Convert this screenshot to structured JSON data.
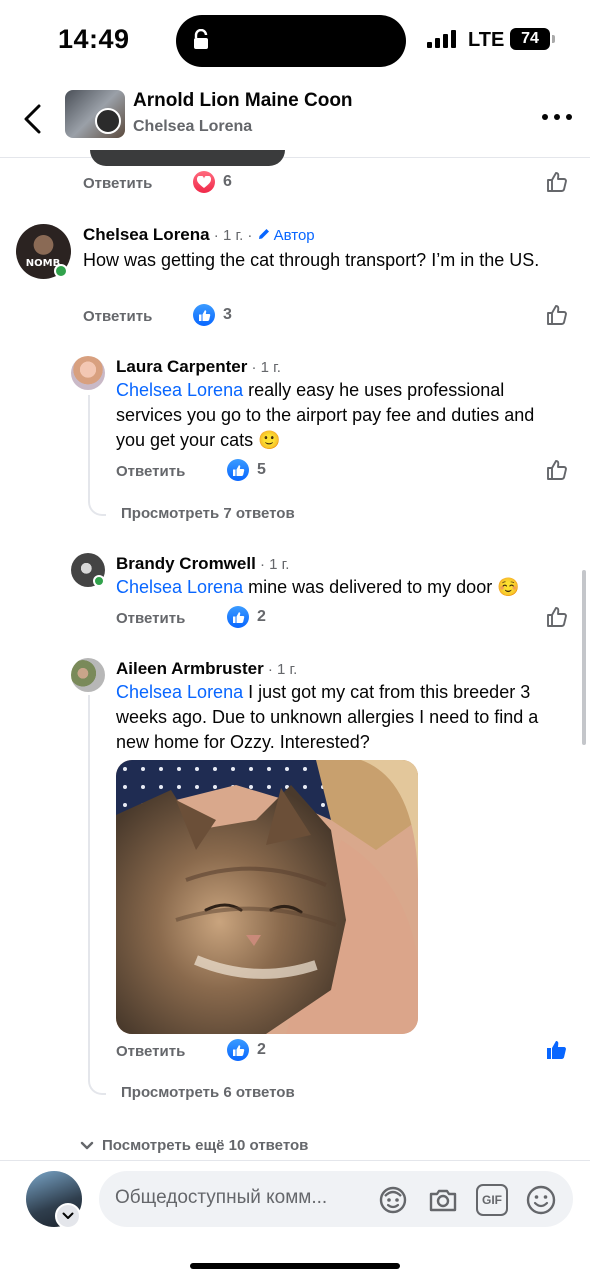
{
  "status_bar": {
    "time": "14:49",
    "network": "LTE",
    "battery": "74"
  },
  "header": {
    "title": "Arnold Lion Maine Coon",
    "subtitle": "Chelsea Lorena",
    "back_icon": "chevron-left-icon",
    "more_icon": "more-horizontal-icon"
  },
  "comments": [
    {
      "reply_label": "Ответить",
      "reaction_type": "heart",
      "reaction_count": "6"
    },
    {
      "author": "Chelsea Lorena",
      "meta": " · 1 г. · ",
      "badge": "Автор",
      "text": "How was getting the cat through transport? I’m in the US.",
      "reply_label": "Ответить",
      "reaction_count": "3"
    },
    {
      "author": "Laura Carpenter",
      "meta": " · 1 г.",
      "mention": "Chelsea Lorena",
      "text": " really easy he uses professional services you go to the airport pay fee and duties and you get your cats 🙂",
      "reply_label": "Ответить",
      "reaction_count": "5",
      "view_replies": "Просмотреть 7 ответов"
    },
    {
      "author": "Brandy Cromwell",
      "meta": " · 1 г.",
      "mention": "Chelsea Lorena",
      "text": " mine was delivered to my door ☺️",
      "reply_label": "Ответить",
      "reaction_count": "2"
    },
    {
      "author": "Aileen Armbruster",
      "meta": " · 1 г.",
      "mention": "Chelsea Lorena",
      "text": " I just got my cat from this breeder 3 weeks ago.  Due to unknown allergies I need to find a new home for Ozzy. Interested?",
      "reply_label": "Ответить",
      "reaction_count": "2",
      "view_replies": "Просмотреть 6 ответов"
    }
  ],
  "more_replies": "Посмотреть ещё 10 ответов",
  "composer": {
    "placeholder": "Общедоступный комм...",
    "gif_label": "GIF"
  },
  "colors": {
    "accent": "#0866ff",
    "secondary_text": "#65676b",
    "online": "#31a24c",
    "heart": "#f02849"
  }
}
